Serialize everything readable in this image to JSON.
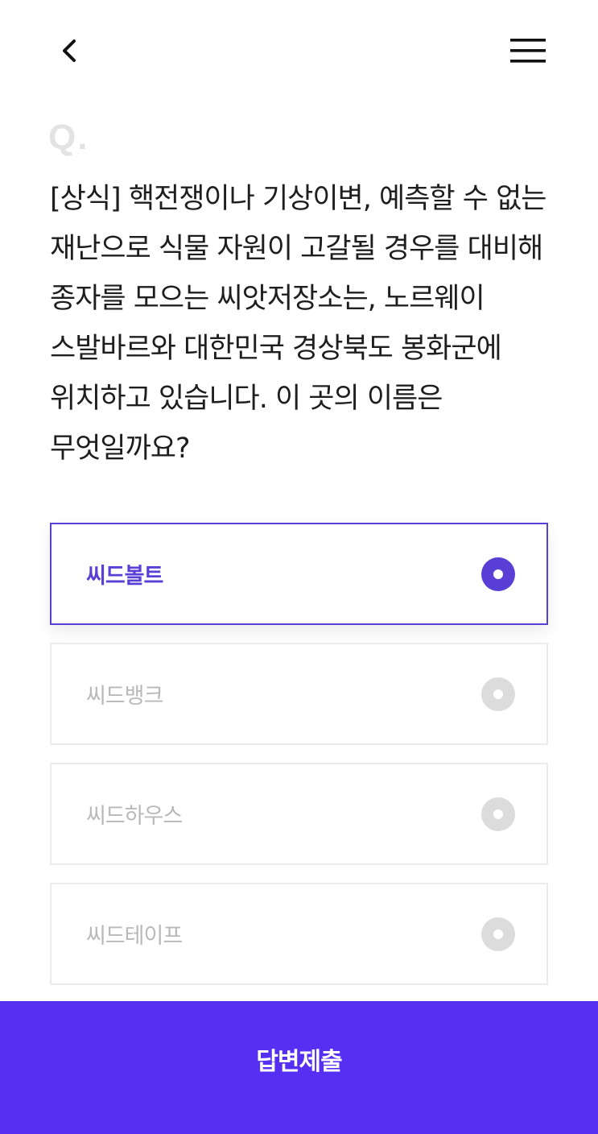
{
  "header": {
    "back_icon": "chevron-left-icon",
    "menu_icon": "hamburger-menu-icon"
  },
  "quiz": {
    "q_mark": "Q.",
    "question": "[상식] 핵전쟁이나 기상이변, 예측할 수 없는 재난으로 식물 자원이 고갈될 경우를 대비해 종자를 모으는 씨앗저장소는, 노르웨이 스발바르와 대한민국 경상북도 봉화군에 위치하고 있습니다. 이 곳의 이름은 무엇일까요?",
    "options": [
      {
        "label": "씨드볼트",
        "selected": true
      },
      {
        "label": "씨드뱅크",
        "selected": false
      },
      {
        "label": "씨드하우스",
        "selected": false
      },
      {
        "label": "씨드테이프",
        "selected": false
      }
    ]
  },
  "submit": {
    "label": "답변제출"
  },
  "colors": {
    "accent": "#5a3fd6",
    "submit_bg": "#5530f3",
    "unselected_text": "#b9b9b9",
    "unselected_radio": "#dcdcdc"
  }
}
